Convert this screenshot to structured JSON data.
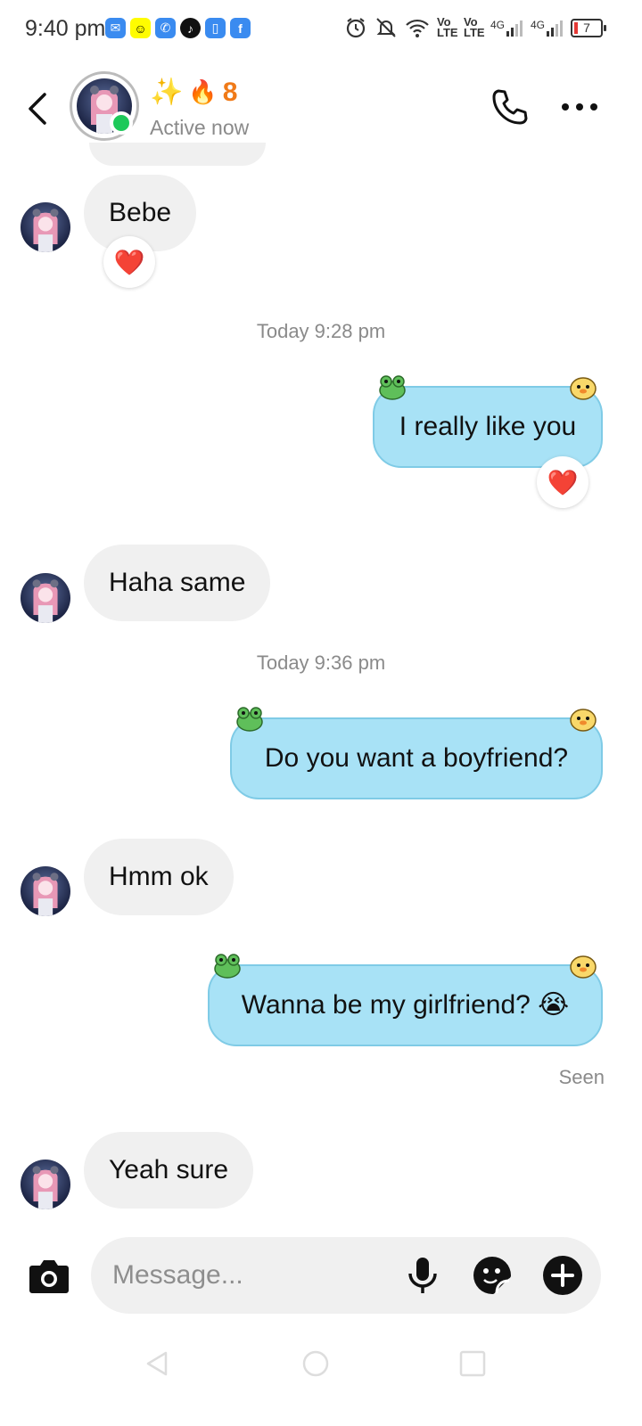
{
  "status_bar": {
    "time": "9:40 pm",
    "app_icons": [
      "messenger-icon",
      "snapchat-icon",
      "missed-call-icon",
      "tiktok-icon",
      "sim-toolkit-icon",
      "facebook-icon"
    ],
    "network_1": "Vo LTE",
    "network_2": "Vo LTE",
    "net_type_1": "4G",
    "net_type_2": "4G",
    "battery": "7"
  },
  "header": {
    "emoji": "✨",
    "streak_emoji": "🔥",
    "streak_count": "8",
    "status": "Active now"
  },
  "messages": {
    "bebe": "Bebe",
    "bebe_reaction": "❤️",
    "ts1": "Today 9:28 pm",
    "out1": "I really like you",
    "out1_reaction": "❤️",
    "in2": "Haha same",
    "ts2": "Today 9:36 pm",
    "out2": "Do you want a boyfriend?",
    "in3": "Hmm ok",
    "out3": "Wanna be my girlfriend? 😭",
    "seen": "Seen",
    "in4": "Yeah sure"
  },
  "composer": {
    "placeholder": "Message..."
  },
  "colors": {
    "outgoing_bubble": "#a8e2f6",
    "incoming_bubble": "#f0f0f0",
    "online_dot": "#1ec95a",
    "streak": "#f07a18"
  }
}
